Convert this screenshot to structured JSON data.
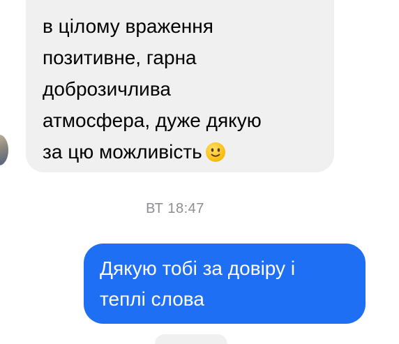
{
  "conversation": {
    "incoming_message": {
      "text": "в цілому враження\nпозитивне, гарна\nдоброзичлива\nатмосфера, дуже дякую\nза цю можливість",
      "emoji": "slightly-smiling-face-icon"
    },
    "timestamp": "ВТ 18:47",
    "outgoing_message": {
      "text": "Дякую тобі за довіру і\nтеплі слова"
    }
  },
  "colors": {
    "incoming_bubble": "#f0f0f0",
    "outgoing_bubble": "#1f6ff5",
    "timestamp_text": "#8e8e93",
    "emoji_face": "#ffc83d"
  }
}
